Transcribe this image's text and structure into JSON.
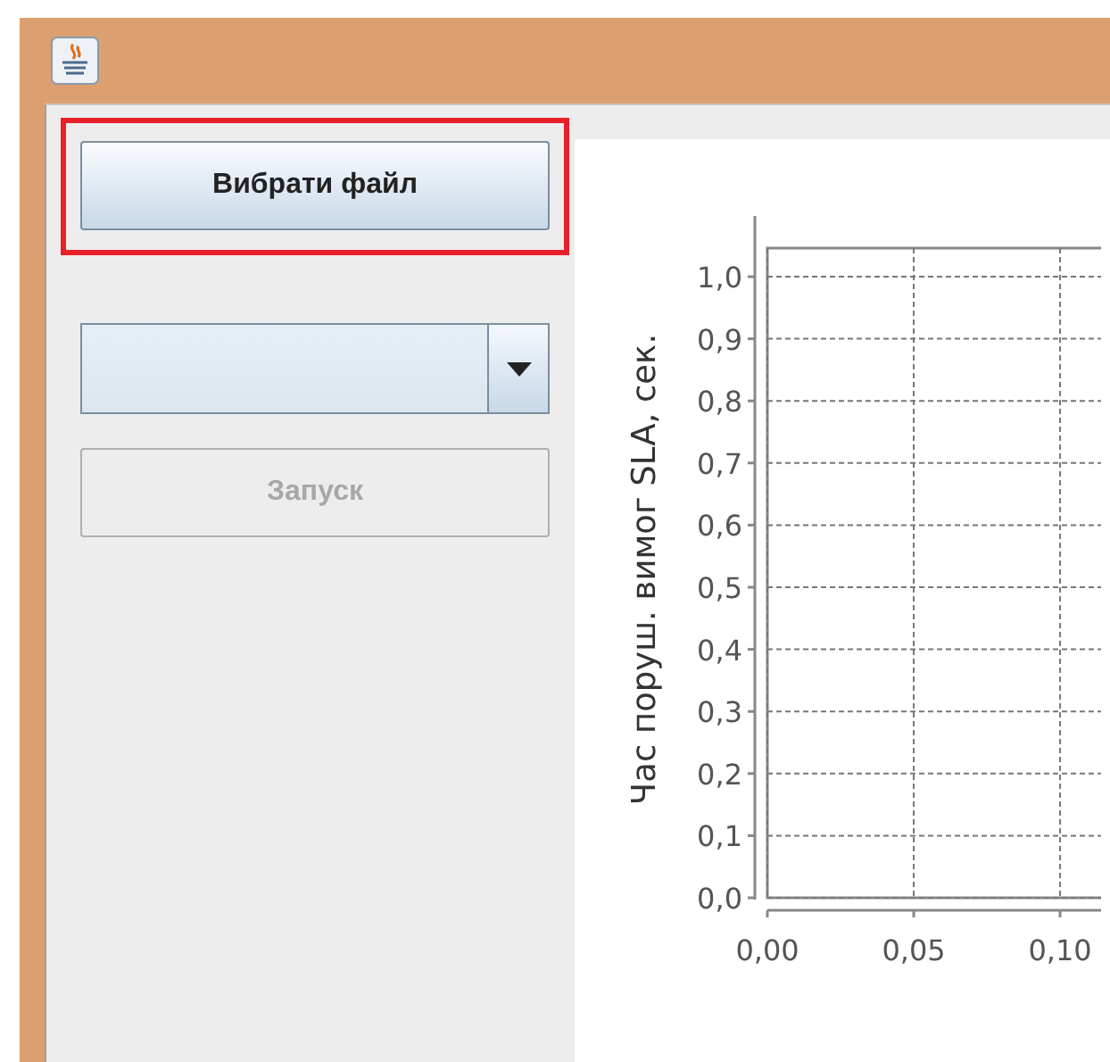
{
  "left_panel": {
    "choose_file_button": {
      "label": "Вибрати файл",
      "highlighted": true
    },
    "combo_box": {
      "disabled": false
    },
    "run_button": {
      "label": "Запуск",
      "disabled": true
    }
  },
  "chart": {
    "chart_data": {
      "type": "line",
      "grid": true,
      "ylabel": "Час поруш. вимог SLA, сек.",
      "xlim": [
        0,
        0.114
      ],
      "ylim": [
        0,
        1.046
      ],
      "xticks": [
        {
          "value": 0,
          "label": "0,00"
        },
        {
          "value": 0.05,
          "label": "0,05"
        },
        {
          "value": 0.1,
          "label": "0,10"
        }
      ],
      "yticks": [
        {
          "value": 0,
          "label": "0,0"
        },
        {
          "value": 0.1,
          "label": "0,1"
        },
        {
          "value": 0.2,
          "label": "0,2"
        },
        {
          "value": 0.3,
          "label": "0,3"
        },
        {
          "value": 0.4,
          "label": "0,4"
        },
        {
          "value": 0.5,
          "label": "0,5"
        },
        {
          "value": 0.6,
          "label": "0,6"
        },
        {
          "value": 0.7,
          "label": "0,7"
        },
        {
          "value": 0.8,
          "label": "0,8"
        },
        {
          "value": 0.9,
          "label": "0,9"
        },
        {
          "value": 1,
          "label": "1,0"
        }
      ]
    }
  }
}
